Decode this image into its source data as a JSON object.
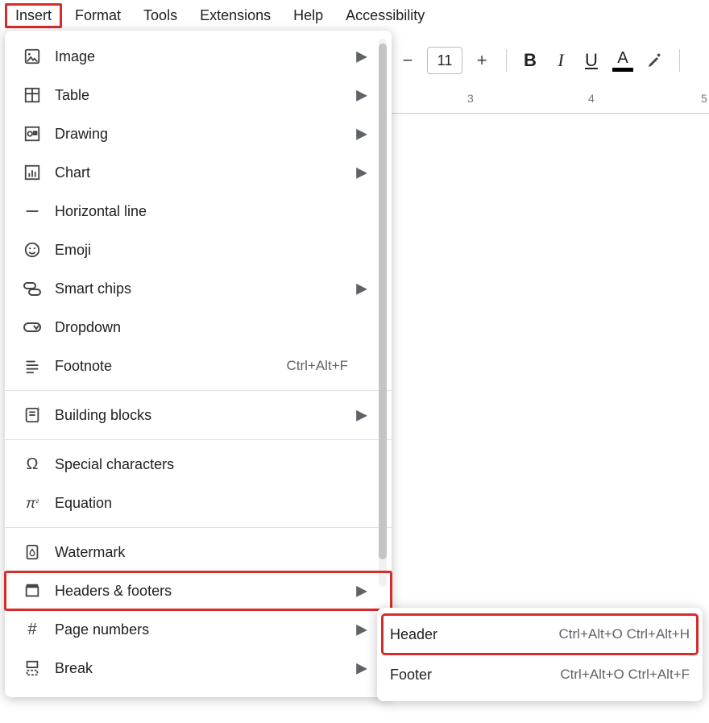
{
  "menubar": {
    "items": [
      "Insert",
      "Format",
      "Tools",
      "Extensions",
      "Help",
      "Accessibility"
    ],
    "active": "Insert"
  },
  "toolbar": {
    "font_size": "11",
    "bold": "B",
    "italic": "I",
    "underline": "U",
    "text_color": "A"
  },
  "ruler": {
    "labels": [
      "3",
      "4",
      "5"
    ]
  },
  "insert_menu": {
    "items": [
      {
        "label": "Image",
        "icon": "image",
        "has_submenu": true
      },
      {
        "label": "Table",
        "icon": "table",
        "has_submenu": true
      },
      {
        "label": "Drawing",
        "icon": "drawing",
        "has_submenu": true
      },
      {
        "label": "Chart",
        "icon": "chart",
        "has_submenu": true
      },
      {
        "label": "Horizontal line",
        "icon": "hr",
        "has_submenu": false
      },
      {
        "label": "Emoji",
        "icon": "emoji",
        "has_submenu": false
      },
      {
        "label": "Smart chips",
        "icon": "chips",
        "has_submenu": true
      },
      {
        "label": "Dropdown",
        "icon": "dropdown",
        "has_submenu": false
      },
      {
        "label": "Footnote",
        "icon": "footnote",
        "has_submenu": false,
        "shortcut": "Ctrl+Alt+F"
      },
      {
        "divider": true
      },
      {
        "label": "Building blocks",
        "icon": "blocks",
        "has_submenu": true
      },
      {
        "divider": true
      },
      {
        "label": "Special characters",
        "icon": "omega",
        "has_submenu": false
      },
      {
        "label": "Equation",
        "icon": "equation",
        "has_submenu": false
      },
      {
        "divider": true
      },
      {
        "label": "Watermark",
        "icon": "watermark",
        "has_submenu": false
      },
      {
        "label": "Headers & footers",
        "icon": "headerfooter",
        "has_submenu": true,
        "highlighted": true
      },
      {
        "label": "Page numbers",
        "icon": "pagenum",
        "has_submenu": true
      },
      {
        "label": "Break",
        "icon": "break",
        "has_submenu": true
      }
    ]
  },
  "headers_footers_submenu": {
    "items": [
      {
        "label": "Header",
        "shortcut": "Ctrl+Alt+O Ctrl+Alt+H",
        "highlighted": true
      },
      {
        "label": "Footer",
        "shortcut": "Ctrl+Alt+O Ctrl+Alt+F",
        "highlighted": false
      }
    ]
  }
}
